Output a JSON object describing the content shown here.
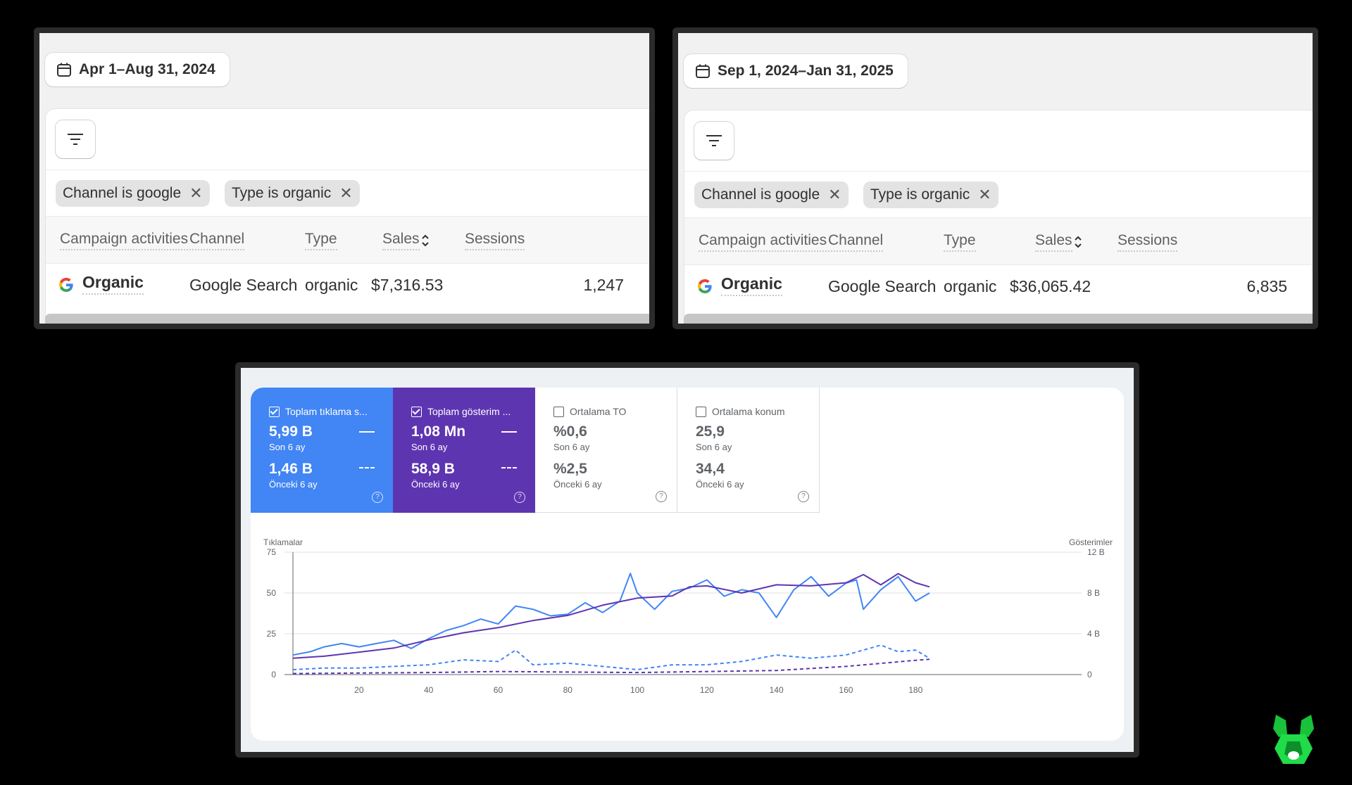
{
  "panels": [
    {
      "date_range": "Apr 1–Aug 31, 2024",
      "filters": [
        "Channel is google",
        "Type is organic"
      ],
      "columns": [
        "Campaign activities",
        "Channel",
        "Type",
        "Sales",
        "Sessions"
      ],
      "row": {
        "campaign": "Organic",
        "channel": "Google Search",
        "type": "organic",
        "sales": "$7,316.53",
        "sessions": "1,247"
      }
    },
    {
      "date_range": "Sep 1, 2024–Jan 31, 2025",
      "filters": [
        "Channel is google",
        "Type is organic"
      ],
      "columns": [
        "Campaign activities",
        "Channel",
        "Type",
        "Sales",
        "Sessions"
      ],
      "row": {
        "campaign": "Organic",
        "channel": "Google Search",
        "type": "organic",
        "sales": "$36,065.42",
        "sessions": "6,835"
      }
    }
  ],
  "metrics": [
    {
      "title": "Toplam tıklama s...",
      "checked": true,
      "current": "5,99 B",
      "current_label": "Son 6 ay",
      "previous": "1,46 B",
      "previous_label": "Önceki 6 ay",
      "color": "#4285f4"
    },
    {
      "title": "Toplam gösterim ...",
      "checked": true,
      "current": "1,08 Mn",
      "current_label": "Son 6 ay",
      "previous": "58,9 B",
      "previous_label": "Önceki 6 ay",
      "color": "#5e35b1"
    },
    {
      "title": "Ortalama TO",
      "checked": false,
      "current": "%0,6",
      "current_label": "Son 6 ay",
      "previous": "%2,5",
      "previous_label": "Önceki 6 ay"
    },
    {
      "title": "Ortalama konum",
      "checked": false,
      "current": "25,9",
      "current_label": "Son 6 ay",
      "previous": "34,4",
      "previous_label": "Önceki 6 ay"
    }
  ],
  "chart_data": {
    "type": "line",
    "ylabel_left": "Tıklamalar",
    "ylabel_right": "Gösterimler",
    "yticks_left": [
      "0",
      "25",
      "50",
      "75"
    ],
    "yticks_right": [
      "0",
      "4 B",
      "8 B",
      "12 B"
    ],
    "xticks": [
      20,
      40,
      60,
      80,
      100,
      120,
      140,
      160,
      180
    ],
    "xlim": [
      1,
      184
    ],
    "ylim_left": [
      0,
      75
    ],
    "ylim_right": [
      0,
      12000
    ],
    "series": [
      {
        "axis": "left",
        "style": "solid",
        "color": "#4285f4",
        "x": [
          1,
          6,
          10,
          15,
          20,
          25,
          30,
          35,
          40,
          45,
          50,
          55,
          60,
          65,
          70,
          75,
          80,
          85,
          90,
          95,
          98,
          100,
          105,
          110,
          115,
          120,
          125,
          130,
          135,
          140,
          145,
          150,
          155,
          160,
          163,
          165,
          170,
          175,
          180,
          184
        ],
        "values": [
          12,
          14,
          17,
          19,
          17,
          19,
          21,
          16,
          22,
          27,
          30,
          34,
          31,
          42,
          40,
          36,
          37,
          44,
          38,
          45,
          62,
          50,
          40,
          51,
          53,
          58,
          48,
          52,
          50,
          35,
          52,
          60,
          48,
          56,
          58,
          40,
          52,
          60,
          45,
          50
        ]
      },
      {
        "axis": "right",
        "style": "solid",
        "color": "#5e35b1",
        "x": [
          1,
          10,
          20,
          30,
          40,
          50,
          60,
          70,
          80,
          90,
          100,
          110,
          115,
          120,
          130,
          140,
          150,
          160,
          165,
          170,
          175,
          180,
          184
        ],
        "values": [
          1600,
          1800,
          2200,
          2600,
          3400,
          4100,
          4600,
          5300,
          5800,
          6800,
          7500,
          7700,
          8600,
          8700,
          8000,
          8800,
          8700,
          9000,
          9800,
          8800,
          9900,
          9000,
          8600
        ]
      },
      {
        "axis": "left",
        "style": "dashed",
        "color": "#4285f4",
        "x": [
          1,
          10,
          20,
          30,
          40,
          50,
          60,
          65,
          70,
          80,
          90,
          100,
          110,
          120,
          130,
          140,
          150,
          160,
          170,
          175,
          180,
          184
        ],
        "values": [
          3,
          4,
          4,
          5,
          6,
          9,
          8,
          15,
          6,
          7,
          5,
          3,
          6,
          6,
          8,
          12,
          10,
          12,
          18,
          14,
          15,
          10
        ]
      },
      {
        "axis": "right",
        "style": "dashed",
        "color": "#5e35b1",
        "x": [
          1,
          20,
          40,
          60,
          80,
          100,
          120,
          140,
          150,
          160,
          170,
          180,
          184
        ],
        "values": [
          100,
          150,
          200,
          300,
          250,
          200,
          300,
          400,
          600,
          800,
          1100,
          1400,
          1500
        ]
      }
    ]
  }
}
